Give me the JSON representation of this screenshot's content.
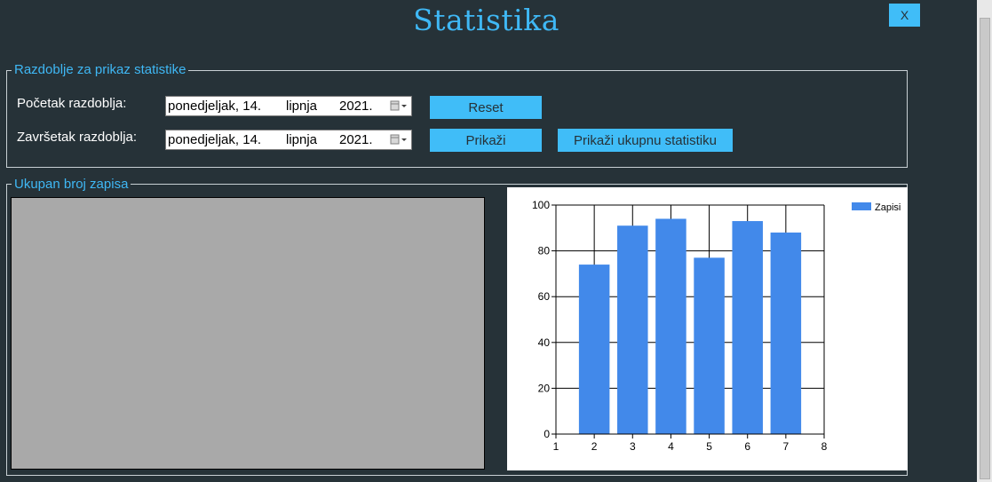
{
  "window": {
    "title": "Statistika",
    "close_label": "X"
  },
  "period_group": {
    "legend": "Razdoblje za prikaz statistike",
    "start_label": "Početak razdoblja:",
    "end_label": "Završetak razdoblja:",
    "start_date": {
      "weekday_day": "ponedjeljak, 14.",
      "month": "lipnja",
      "year": "2021."
    },
    "end_date": {
      "weekday_day": "ponedjeljak, 14.",
      "month": "lipnja",
      "year": "2021."
    },
    "reset_button": "Reset",
    "show_button": "Prikaži",
    "show_total_button": "Prikaži ukupnu statistiku"
  },
  "records_group": {
    "legend": "Ukupan broj zapisa"
  },
  "colors": {
    "background": "#263238",
    "accent": "#40bdf8",
    "bar": "#4289ea"
  },
  "chart_data": {
    "type": "bar",
    "x": [
      2,
      3,
      4,
      5,
      6,
      7
    ],
    "series": [
      {
        "name": "Zapisi",
        "values": [
          74,
          91,
          94,
          77,
          93,
          88
        ]
      }
    ],
    "xlim": [
      1,
      8
    ],
    "ylim": [
      0,
      100
    ],
    "x_ticks": [
      1,
      2,
      3,
      4,
      5,
      6,
      7,
      8
    ],
    "y_ticks": [
      0,
      20,
      40,
      60,
      80,
      100
    ],
    "grid": true,
    "legend_position": "top-right"
  }
}
